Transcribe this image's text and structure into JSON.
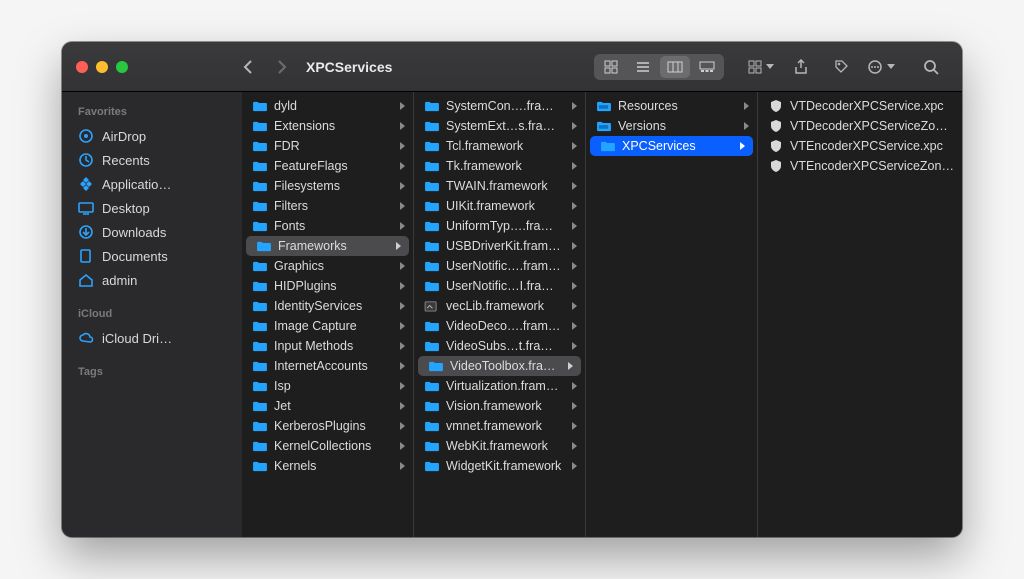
{
  "window": {
    "title": "XPCServices"
  },
  "toolbar": {
    "back_enabled": true,
    "forward_enabled": false,
    "views": [
      "icon",
      "list",
      "column",
      "gallery"
    ],
    "active_view": "column"
  },
  "sidebar": {
    "sections": [
      {
        "title": "Favorites",
        "items": [
          {
            "icon": "airdrop-icon",
            "label": "AirDrop"
          },
          {
            "icon": "clock-icon",
            "label": "Recents"
          },
          {
            "icon": "apps-icon",
            "label": "Applicatio…"
          },
          {
            "icon": "desktop-icon",
            "label": "Desktop"
          },
          {
            "icon": "download-icon",
            "label": "Downloads"
          },
          {
            "icon": "documents-icon",
            "label": "Documents"
          },
          {
            "icon": "home-icon",
            "label": "admin"
          }
        ]
      },
      {
        "title": "iCloud",
        "items": [
          {
            "icon": "cloud-icon",
            "label": "iCloud Dri…"
          }
        ]
      },
      {
        "title": "Tags",
        "items": []
      }
    ]
  },
  "columns": [
    {
      "selected_index": 7,
      "items": [
        {
          "name": "dyld",
          "type": "folder",
          "children": true
        },
        {
          "name": "Extensions",
          "type": "folder",
          "children": true
        },
        {
          "name": "FDR",
          "type": "folder",
          "children": true
        },
        {
          "name": "FeatureFlags",
          "type": "folder",
          "children": true
        },
        {
          "name": "Filesystems",
          "type": "folder",
          "children": true
        },
        {
          "name": "Filters",
          "type": "folder",
          "children": true
        },
        {
          "name": "Fonts",
          "type": "folder",
          "children": true
        },
        {
          "name": "Frameworks",
          "type": "folder",
          "children": true
        },
        {
          "name": "Graphics",
          "type": "folder",
          "children": true
        },
        {
          "name": "HIDPlugins",
          "type": "folder",
          "children": true
        },
        {
          "name": "IdentityServices",
          "type": "folder",
          "children": true
        },
        {
          "name": "Image Capture",
          "type": "folder",
          "children": true
        },
        {
          "name": "Input Methods",
          "type": "folder",
          "children": true
        },
        {
          "name": "InternetAccounts",
          "type": "folder",
          "children": true
        },
        {
          "name": "Isp",
          "type": "folder",
          "children": true
        },
        {
          "name": "Jet",
          "type": "folder",
          "children": true
        },
        {
          "name": "KerberosPlugins",
          "type": "folder",
          "children": true
        },
        {
          "name": "KernelCollections",
          "type": "folder",
          "children": true
        },
        {
          "name": "Kernels",
          "type": "folder",
          "children": true
        }
      ]
    },
    {
      "selected_index": 13,
      "items": [
        {
          "name": "SystemCon….framework",
          "type": "folder",
          "children": true
        },
        {
          "name": "SystemExt…s.framework",
          "type": "folder",
          "children": true
        },
        {
          "name": "Tcl.framework",
          "type": "folder",
          "children": true
        },
        {
          "name": "Tk.framework",
          "type": "folder",
          "children": true
        },
        {
          "name": "TWAIN.framework",
          "type": "folder",
          "children": true
        },
        {
          "name": "UIKit.framework",
          "type": "folder",
          "children": true
        },
        {
          "name": "UniformTyp….framework",
          "type": "folder",
          "children": true
        },
        {
          "name": "USBDriverKit.framework",
          "type": "folder",
          "children": true
        },
        {
          "name": "UserNotific….framework",
          "type": "folder",
          "children": true
        },
        {
          "name": "UserNotific…I.framework",
          "type": "folder",
          "children": true
        },
        {
          "name": "vecLib.framework",
          "type": "alias",
          "children": true
        },
        {
          "name": "VideoDeco….framework",
          "type": "folder",
          "children": true
        },
        {
          "name": "VideoSubs…t.framework",
          "type": "folder",
          "children": true
        },
        {
          "name": "VideoToolbox.framework",
          "type": "folder",
          "children": true
        },
        {
          "name": "Virtualization.framework",
          "type": "folder",
          "children": true
        },
        {
          "name": "Vision.framework",
          "type": "folder",
          "children": true
        },
        {
          "name": "vmnet.framework",
          "type": "folder",
          "children": true
        },
        {
          "name": "WebKit.framework",
          "type": "folder",
          "children": true
        },
        {
          "name": "WidgetKit.framework",
          "type": "folder",
          "children": true
        }
      ]
    },
    {
      "selected_index": 2,
      "selected_active": true,
      "items": [
        {
          "name": "Resources",
          "type": "folder-open",
          "children": true
        },
        {
          "name": "Versions",
          "type": "folder-open",
          "children": true
        },
        {
          "name": "XPCServices",
          "type": "folder",
          "children": true
        }
      ]
    },
    {
      "selected_index": -1,
      "items": [
        {
          "name": "VTDecoderXPCService.xpc",
          "type": "xpc",
          "children": false
        },
        {
          "name": "VTDecoderXPCServiceZonto.xpc",
          "type": "xpc",
          "children": false
        },
        {
          "name": "VTEncoderXPCService.xpc",
          "type": "xpc",
          "children": false
        },
        {
          "name": "VTEncoderXPCServiceZonto.xpc",
          "type": "xpc",
          "children": false
        }
      ]
    }
  ],
  "colors": {
    "folder": "#22a4ff",
    "selection_active": "#0a60ff",
    "selection_inactive": "#4b4b4d"
  }
}
